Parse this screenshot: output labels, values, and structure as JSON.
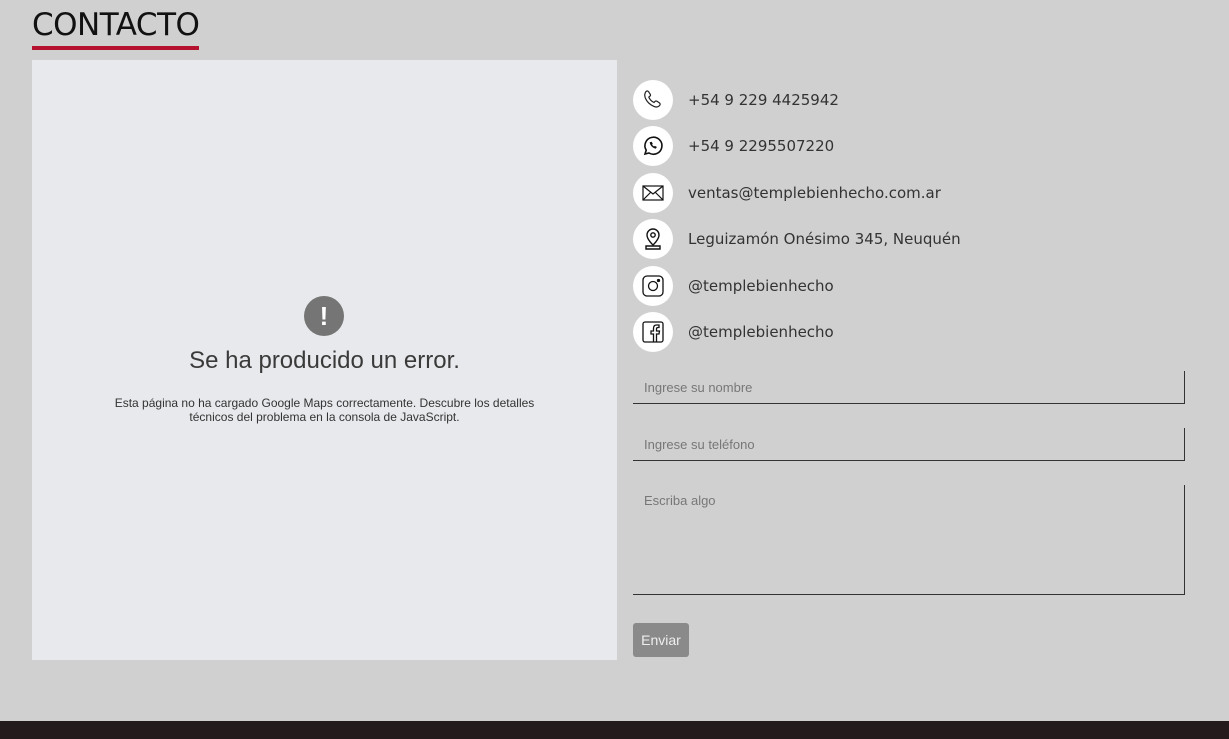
{
  "section_title": "CONTACTO",
  "map_error": {
    "icon_glyph": "!",
    "title": "Se ha producido un error.",
    "description": "Esta página no ha cargado Google Maps correctamente. Descubre los detalles técnicos del problema en la consola de JavaScript."
  },
  "contacts": [
    {
      "icon": "phone-icon",
      "text": "+54 9 229 4425942"
    },
    {
      "icon": "whatsapp-icon",
      "text": "+54 9 2295507220"
    },
    {
      "icon": "mail-icon",
      "text": "ventas@templebienhecho.com.ar"
    },
    {
      "icon": "location-pin-icon",
      "text": "Leguizamón Onésimo 345, Neuquén"
    },
    {
      "icon": "instagram-icon",
      "text": "@templebienhecho"
    },
    {
      "icon": "facebook-icon",
      "text": "@templebienhecho"
    }
  ],
  "form": {
    "name_placeholder": "Ingrese su nombre",
    "phone_placeholder": "Ingrese su teléfono",
    "message_placeholder": "Escriba algo",
    "submit_label": "Enviar"
  },
  "colors": {
    "accent": "#b5122f",
    "page_background": "#d0d0d0",
    "map_background": "#e8e9ec",
    "footer": "#241c1c",
    "button": "#8a8a8a"
  }
}
